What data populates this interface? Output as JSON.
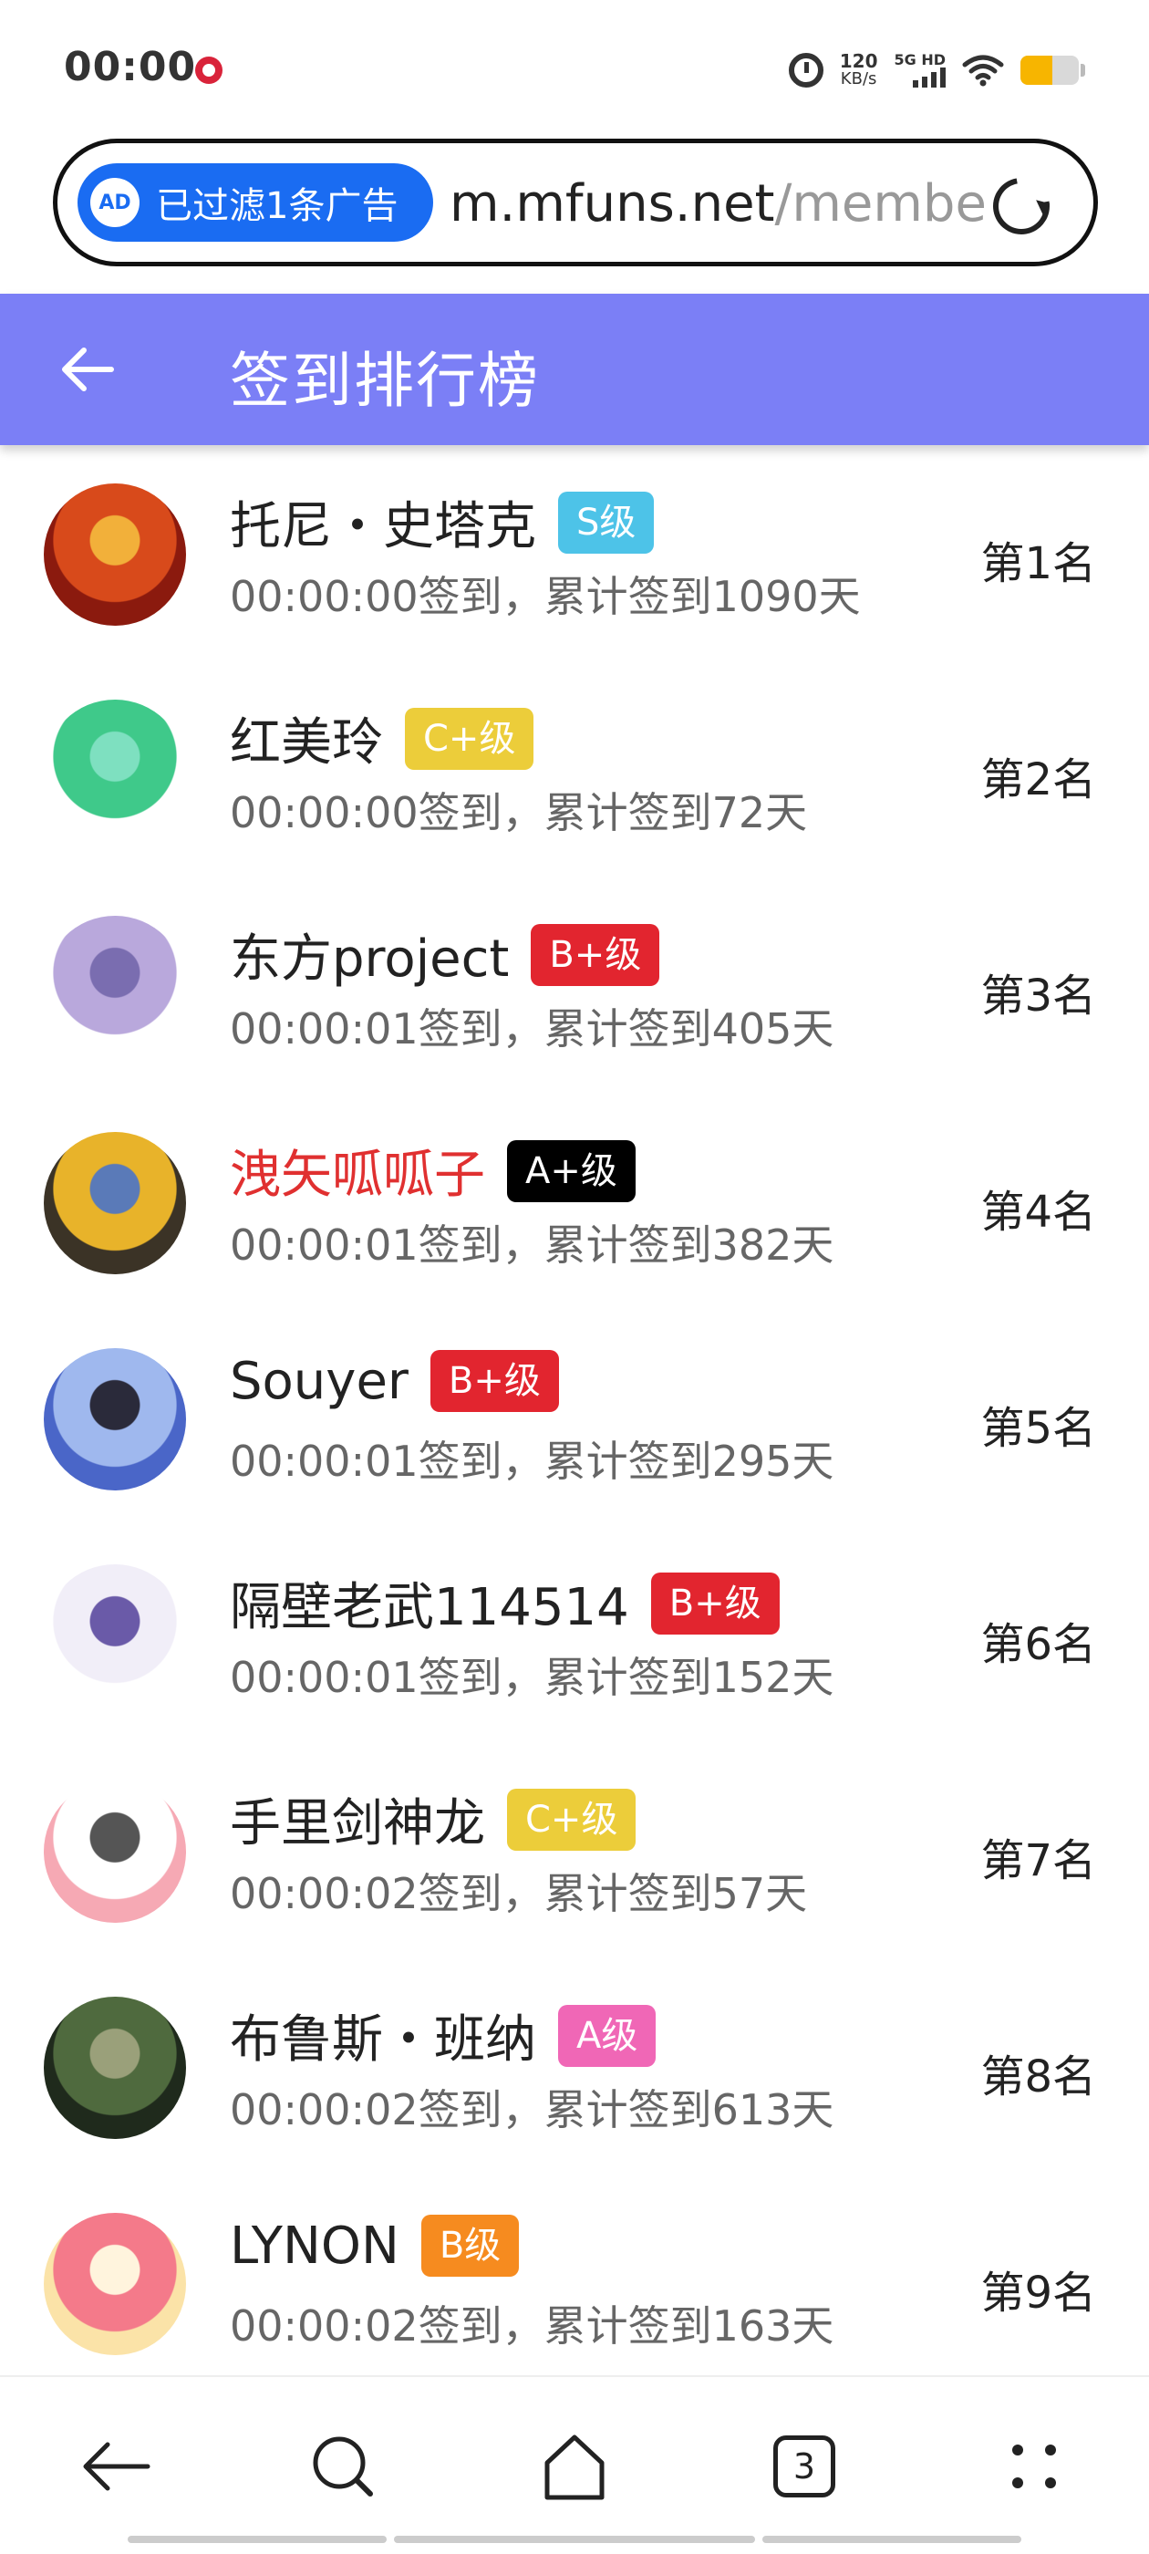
{
  "status_bar": {
    "time": "00:00",
    "net_speed": "120",
    "net_speed_unit": "KB/s",
    "network_label": "5G HD",
    "battery_percent": 55
  },
  "url_bar": {
    "ad_filter_label": "已过滤1条广告",
    "ad_icon_text": "AD",
    "domain": "m.mfuns.net",
    "path": "/membe"
  },
  "header": {
    "title": "签到排行榜"
  },
  "rankings": [
    {
      "name": "托尼・史塔克",
      "level": "S级",
      "badge_color": "#4dc3e8",
      "checkin": "00:00:00签到，累计签到1090天",
      "rank": "第1名",
      "name_color": "#222222",
      "avatar_colors": [
        "#8b1a0e",
        "#d84a1b",
        "#f2b03a"
      ]
    },
    {
      "name": "红美玲",
      "level": "C+级",
      "badge_color": "#eccd3a",
      "checkin": "00:00:00签到，累计签到72天",
      "rank": "第2名",
      "name_color": "#222222",
      "avatar_colors": [
        "#ffffff",
        "#3fc98a",
        "#7ee0c0"
      ]
    },
    {
      "name": "东方project",
      "level": "B+级",
      "badge_color": "#e2252f",
      "checkin": "00:00:01签到，累计签到405天",
      "rank": "第3名",
      "name_color": "#222222",
      "avatar_colors": [
        "#ffffff",
        "#b9a8dc",
        "#7a6db0"
      ]
    },
    {
      "name": "洩矢呱呱子",
      "level": "A+级",
      "badge_color": "#000000",
      "checkin": "00:00:01签到，累计签到382天",
      "rank": "第4名",
      "name_color": "#e03030",
      "avatar_colors": [
        "#3b3326",
        "#e8b32a",
        "#5a7ab8"
      ]
    },
    {
      "name": "Souyer",
      "level": "B+级",
      "badge_color": "#e2252f",
      "checkin": "00:00:01签到，累计签到295天",
      "rank": "第5名",
      "name_color": "#222222",
      "avatar_colors": [
        "#4a66c8",
        "#9fb8ee",
        "#2a2a3a"
      ]
    },
    {
      "name": "隔壁老武114514",
      "level": "B+级",
      "badge_color": "#e2252f",
      "checkin": "00:00:01签到，累计签到152天",
      "rank": "第6名",
      "name_color": "#222222",
      "avatar_colors": [
        "#ffffff",
        "#f1eef8",
        "#6a5aa8"
      ]
    },
    {
      "name": "手里剑神龙",
      "level": "C+级",
      "badge_color": "#eccd3a",
      "checkin": "00:00:02签到，累计签到57天",
      "rank": "第7名",
      "name_color": "#222222",
      "avatar_colors": [
        "#f6a9b4",
        "#ffffff",
        "#555555"
      ]
    },
    {
      "name": "布鲁斯・班纳",
      "level": "A级",
      "badge_color": "#f067b6",
      "checkin": "00:00:02签到，累计签到613天",
      "rank": "第8名",
      "name_color": "#222222",
      "avatar_colors": [
        "#1f2a1c",
        "#4f6a3e",
        "#9aa07a"
      ]
    },
    {
      "name": "LYNON",
      "level": "B级",
      "badge_color": "#f68b1f",
      "checkin": "00:00:02签到，累计签到163天",
      "rank": "第9名",
      "name_color": "#222222",
      "avatar_colors": [
        "#fbe3a8",
        "#f47a8a",
        "#fff4dd"
      ]
    }
  ],
  "bottom_nav": {
    "items": [
      "back-icon",
      "search-icon",
      "home-icon",
      "tabs-icon",
      "menu-icon"
    ],
    "tabs_count": "3"
  }
}
